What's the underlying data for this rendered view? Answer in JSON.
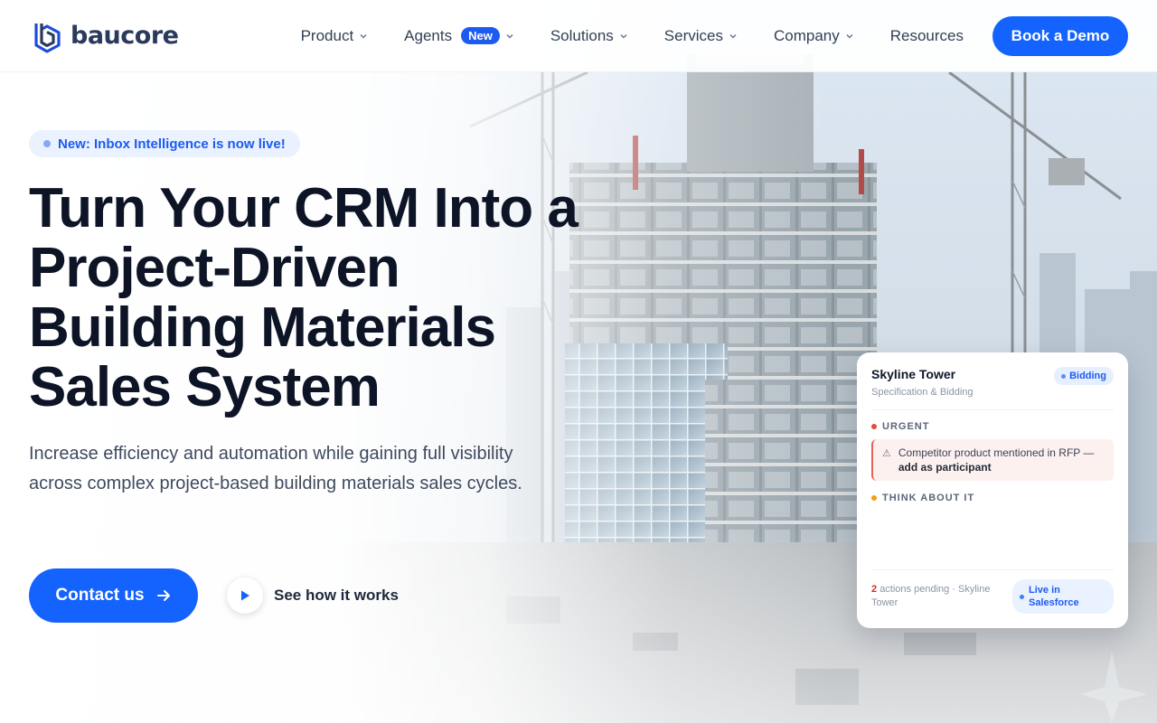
{
  "brand": {
    "name": "baucore",
    "color": "#2a3a5c",
    "accent": "#1463ff"
  },
  "nav": {
    "items": [
      {
        "label": "Product",
        "dropdown": true
      },
      {
        "label": "Agents",
        "badge": "New",
        "dropdown": true
      },
      {
        "label": "Solutions",
        "dropdown": true
      },
      {
        "label": "Services",
        "dropdown": true
      },
      {
        "label": "Company",
        "dropdown": true
      },
      {
        "label": "Resources",
        "dropdown": false
      }
    ],
    "cta_label": "Book a Demo"
  },
  "hero": {
    "announcement": "New: Inbox Intelligence is now live!",
    "title": "Turn Your CRM Into a Project-Driven Building Materials Sales System",
    "subtitle": "Increase efficiency and automation while gaining full visibility across complex project-based building materials sales cycles.",
    "primary_cta": "Contact us",
    "secondary_cta": "See how it works"
  },
  "card": {
    "title": "Skyline Tower",
    "subtitle": "Specification & Bidding",
    "status": "Bidding",
    "urgent_label": "URGENT",
    "urgent_color": "#e5483f",
    "alert_text": "Competitor product mentioned in RFP —",
    "alert_action": "add as participant",
    "think_label": "THINK ABOUT IT",
    "think_color": "#f59e0b",
    "pending_count": "2",
    "pending_text": "actions pending · Skyline Tower",
    "live_label": "Live in Salesforce"
  }
}
